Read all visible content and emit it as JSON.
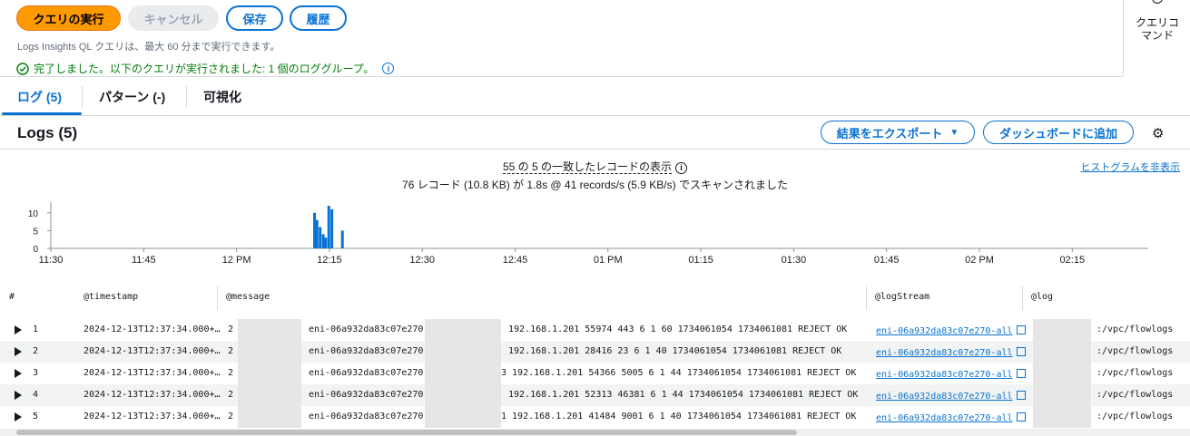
{
  "toolbar": {
    "run_label": "クエリの実行",
    "cancel_label": "キャンセル",
    "save_label": "保存",
    "history_label": "履歴"
  },
  "query_note": "Logs Insights QL クエリは、最大 60 分まで実行できます。",
  "status_message": "完了しました。以下のクエリが実行されました: 1 個のロググループ。",
  "right_panel": {
    "label_line1": "クエリコ",
    "label_line2": "マンド"
  },
  "tabs": [
    {
      "label": "ログ (5)",
      "active": true
    },
    {
      "label": "パターン (-)",
      "active": false
    },
    {
      "label": "可視化",
      "active": false
    }
  ],
  "logs_panel": {
    "title": "Logs (5)",
    "export_label": "結果をエクスポート",
    "dashboard_label": "ダッシュボードに追加",
    "hide_histogram_label": "ヒストグラムを非表示",
    "summary_line1": "55 の 5 の一致したレコードの表示",
    "summary_line2": "76 レコード (10.8 KB) が 1.8s @ 41 records/s (5.9 KB/s) でスキャンされました"
  },
  "chart_data": {
    "type": "bar",
    "y_ticks": [
      "10",
      "5",
      "0"
    ],
    "ylim": [
      0,
      12
    ],
    "x_tick_labels": [
      "11:30",
      "11:45",
      "12 PM",
      "12:15",
      "12:30",
      "12:45",
      "01 PM",
      "01:15",
      "01:30",
      "01:45",
      "02 PM",
      "02:15"
    ],
    "bars": [
      {
        "minute_offset": 42.6,
        "value": 10
      },
      {
        "minute_offset": 43.0,
        "value": 8
      },
      {
        "minute_offset": 43.5,
        "value": 6
      },
      {
        "minute_offset": 44.0,
        "value": 4
      },
      {
        "minute_offset": 44.4,
        "value": 3
      },
      {
        "minute_offset": 44.9,
        "value": 12
      },
      {
        "minute_offset": 45.4,
        "value": 11
      },
      {
        "minute_offset": 47.1,
        "value": 5
      }
    ],
    "color": "#0972d3"
  },
  "table": {
    "headers": [
      "#",
      "@timestamp",
      "@message",
      "@logStream",
      "@log"
    ],
    "rows": [
      {
        "num": "1",
        "timestamp": "2024-12-13T12:37:34.000+…",
        "msg_prefix": "2",
        "eni": "eni-06a932da83c07e270",
        "msg_tail": "192.168.1.201 55974 443 6 1 60 1734061054 1734061081 REJECT OK",
        "stream": "eni-06a932da83c07e270-all",
        "log": ":/vpc/flowlogs"
      },
      {
        "num": "2",
        "timestamp": "2024-12-13T12:37:34.000+…",
        "msg_prefix": "2",
        "eni": "eni-06a932da83c07e270",
        "msg_tail": "192.168.1.201 28416 23 6 1 40 1734061054 1734061081 REJECT OK",
        "stream": "eni-06a932da83c07e270-all",
        "log": ":/vpc/flowlogs"
      },
      {
        "num": "3",
        "timestamp": "2024-12-13T12:37:34.000+…",
        "msg_prefix": "2",
        "eni": "eni-06a932da83c07e270",
        "msg_tail": "3 192.168.1.201 54366 5005 6 1 44 1734061054 1734061081 REJECT OK",
        "stream": "eni-06a932da83c07e270-all",
        "log": ":/vpc/flowlogs"
      },
      {
        "num": "4",
        "timestamp": "2024-12-13T12:37:34.000+…",
        "msg_prefix": "2",
        "eni": "eni-06a932da83c07e270",
        "msg_tail": "192.168.1.201 52313 46381 6 1 44 1734061054 1734061081 REJECT OK",
        "stream": "eni-06a932da83c07e270-all",
        "log": ":/vpc/flowlogs"
      },
      {
        "num": "5",
        "timestamp": "2024-12-13T12:37:34.000+…",
        "msg_prefix": "2",
        "eni": "eni-06a932da83c07e270",
        "msg_tail": "1 192.168.1.201 41484 9001 6 1 40 1734061054 1734061081 REJECT OK",
        "stream": "eni-06a932da83c07e270-all",
        "log": ":/vpc/flowlogs"
      }
    ]
  }
}
